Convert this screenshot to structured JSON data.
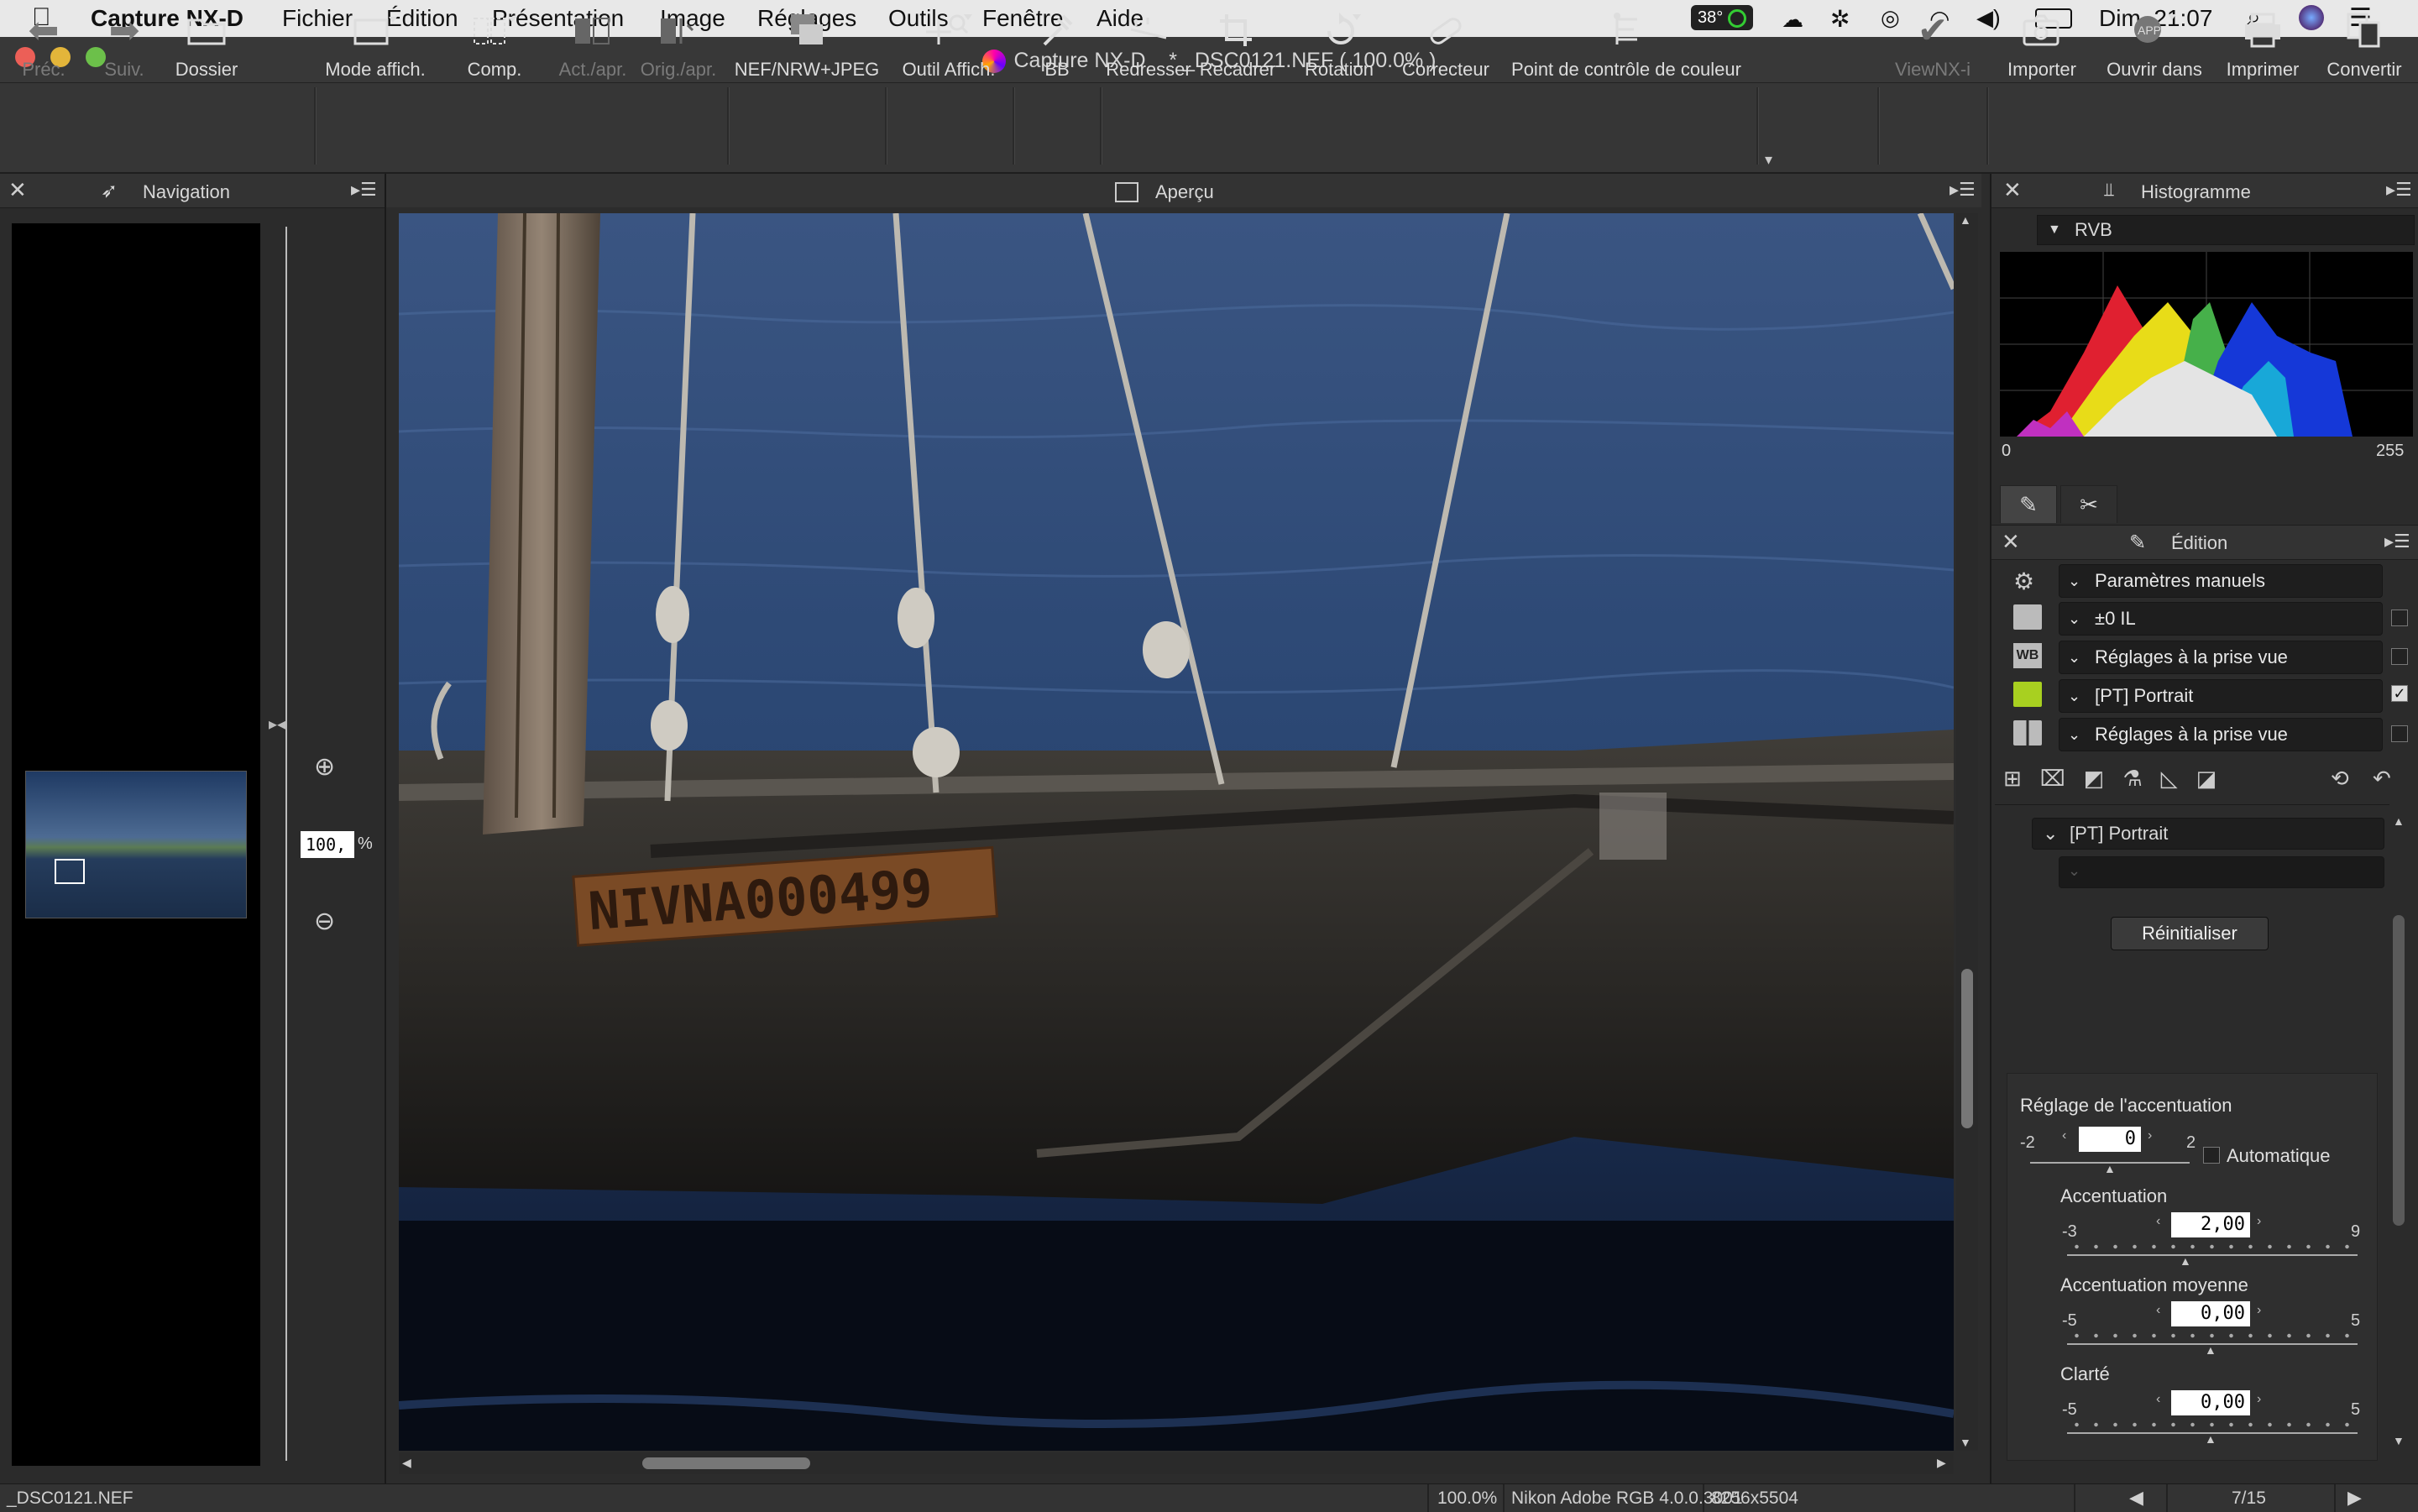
{
  "menubar": {
    "app": "Capture NX-D",
    "items": [
      "Fichier",
      "Édition",
      "Présentation",
      "Image",
      "Réglages",
      "Outils",
      "Fenêtre",
      "Aide"
    ],
    "temp": "38°",
    "datetime": "Dim. 21:07"
  },
  "window": {
    "app_title": "Capture NX-D",
    "doc_title": "* _DSC0121.NEF ( 100.0% )"
  },
  "toolbar": {
    "prev": "Préc.",
    "next": "Suiv.",
    "folder": "Dossier",
    "view_mode": "Mode affich.",
    "compare": "Comp.",
    "before_after": "Act./apr.",
    "orig_after": "Orig./apr.",
    "nef_jpeg": "NEF/NRW+JPEG",
    "view_tool": "Outil Affich.",
    "wb": "BB",
    "straighten": "Redresser",
    "crop": "Recadrer",
    "rotate": "Rotation",
    "retouch": "Correcteur",
    "color_control": "Point de contrôle de couleur",
    "viewnx": "ViewNX-i",
    "import": "Importer",
    "open_in": "Ouvrir dans",
    "print": "Imprimer",
    "convert": "Convertir"
  },
  "navigation": {
    "title": "Navigation",
    "zoom_value": "100,",
    "zoom_unit": "%"
  },
  "viewer": {
    "title": "Aperçu"
  },
  "histogram": {
    "title": "Histogramme",
    "channel": "RVB",
    "min": "0",
    "max": "255"
  },
  "edit": {
    "title": "Édition",
    "rows": [
      {
        "label": "Paramètres manuels"
      },
      {
        "label": "±0 IL"
      },
      {
        "label": "Réglages à la prise vue"
      },
      {
        "label": "[PT] Portrait"
      },
      {
        "label": "Réglages à la prise vue"
      }
    ],
    "picture_control": "[PT] Portrait",
    "reset": "Réinitialiser",
    "sharpening_section": "Réglage de l'accentuation",
    "auto_label": "Automatique",
    "quick": {
      "min": "-2",
      "max": "2",
      "value": "0"
    },
    "sharpening": {
      "label": "Accentuation",
      "min": "-3",
      "max": "9",
      "value": "2,00"
    },
    "mid_sharpening": {
      "label": "Accentuation moyenne",
      "min": "-5",
      "max": "5",
      "value": "0,00"
    },
    "clarity": {
      "label": "Clarté",
      "min": "-5",
      "max": "5",
      "value": "0,00"
    }
  },
  "photo": {
    "plate_text": "NIVNA000499"
  },
  "status": {
    "filename": "_DSC0121.NEF",
    "zoom": "100.0%",
    "profile": "Nikon Adobe RGB 4.0.0.3001",
    "size": "8256x5504",
    "page": "7/15"
  },
  "colors": {
    "accent": "#5a9cff",
    "panel_bg": "#2b2b2b",
    "toolbar_bg": "#363636"
  }
}
